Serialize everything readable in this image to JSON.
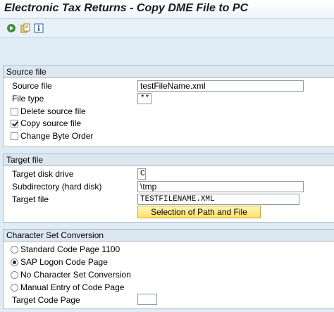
{
  "title": "Electronic Tax Returns - Copy DME File to PC",
  "toolbar": {
    "execute_icon": "execute-icon",
    "variants_icon": "variants-icon",
    "info_icon": "info-icon"
  },
  "source_file_group": {
    "header": "Source file",
    "source_file_label": "Source file",
    "source_file_value": "testFileName.xml",
    "file_type_label": "File type",
    "file_type_value": "**",
    "delete_label": "Delete source file",
    "delete_checked": false,
    "copy_label": "Copy source file",
    "copy_checked": true,
    "byte_order_label": "Change Byte Order",
    "byte_order_checked": false
  },
  "target_file_group": {
    "header": "Target file",
    "disk_label": "Target disk drive",
    "disk_value": "C",
    "subdir_label": "Subdirectory (hard disk)",
    "subdir_value": "\\tmp",
    "target_label": "Target file",
    "target_value": "TESTFILENAME.XML",
    "selection_button": "Selection of Path and File"
  },
  "charset_group": {
    "header": "Character Set Conversion",
    "options": [
      "Standard Code Page 1100",
      "SAP Logon Code Page",
      "No Character Set Conversion",
      "Manual Entry of Code Page"
    ],
    "selected_index": 1,
    "code_page_label": "Target Code Page",
    "code_page_value": ""
  },
  "colors": {
    "background": "#dfebf5",
    "group_header": "#dde7f1",
    "button_yellow": "#ffe066"
  }
}
